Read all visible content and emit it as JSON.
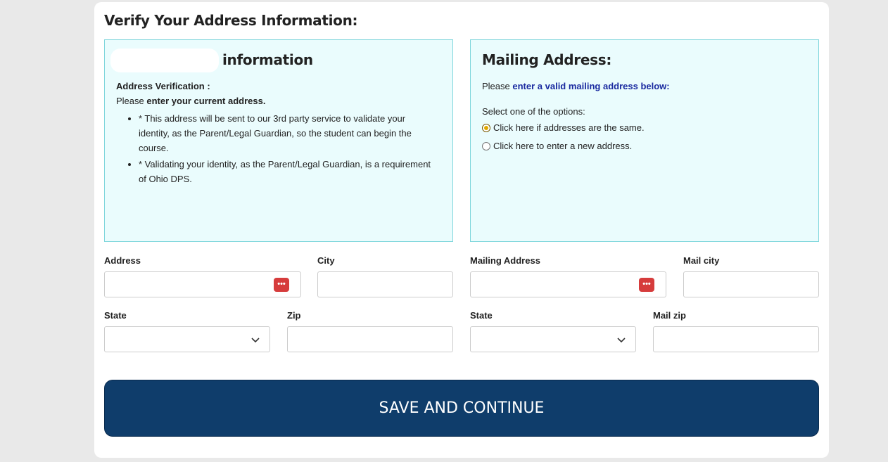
{
  "page": {
    "title": "Verify Your Address Information:"
  },
  "left_panel": {
    "heading": "information",
    "verification_title": "Address Verification :",
    "intro_prefix": "Please ",
    "intro_bold": "enter your current address.",
    "bullets": [
      "* This address will be sent to our 3rd party service to validate your identity, as the Parent/Legal Guardian, so the student can begin the course.",
      "* Validating your identity, as the Parent/Legal Guardian, is a requirement of Ohio DPS."
    ]
  },
  "right_panel": {
    "heading": "Mailing Address:",
    "intro_prefix": "Please ",
    "intro_accent": "enter a valid mailing address below:",
    "options_label": "Select one of the options:",
    "options": [
      {
        "label": "Click here if addresses are the same.",
        "checked": true
      },
      {
        "label": "Click here to enter a new address.",
        "checked": false
      }
    ]
  },
  "form": {
    "address_label": "Address",
    "city_label": "City",
    "mailing_address_label": "Mailing Address",
    "mail_city_label": "Mail city",
    "state_label": "State",
    "zip_label": "Zip",
    "mail_state_label": "State",
    "mail_zip_label": "Mail zip"
  },
  "save_button": {
    "label": "SAVE AND CONTINUE"
  },
  "colors": {
    "panel_bg": "#eafcfd",
    "panel_border": "#7fd6dc",
    "button_bg": "#0f3d6b",
    "accent_text": "#1a2aa0",
    "radio_checked": "#e0a800"
  }
}
